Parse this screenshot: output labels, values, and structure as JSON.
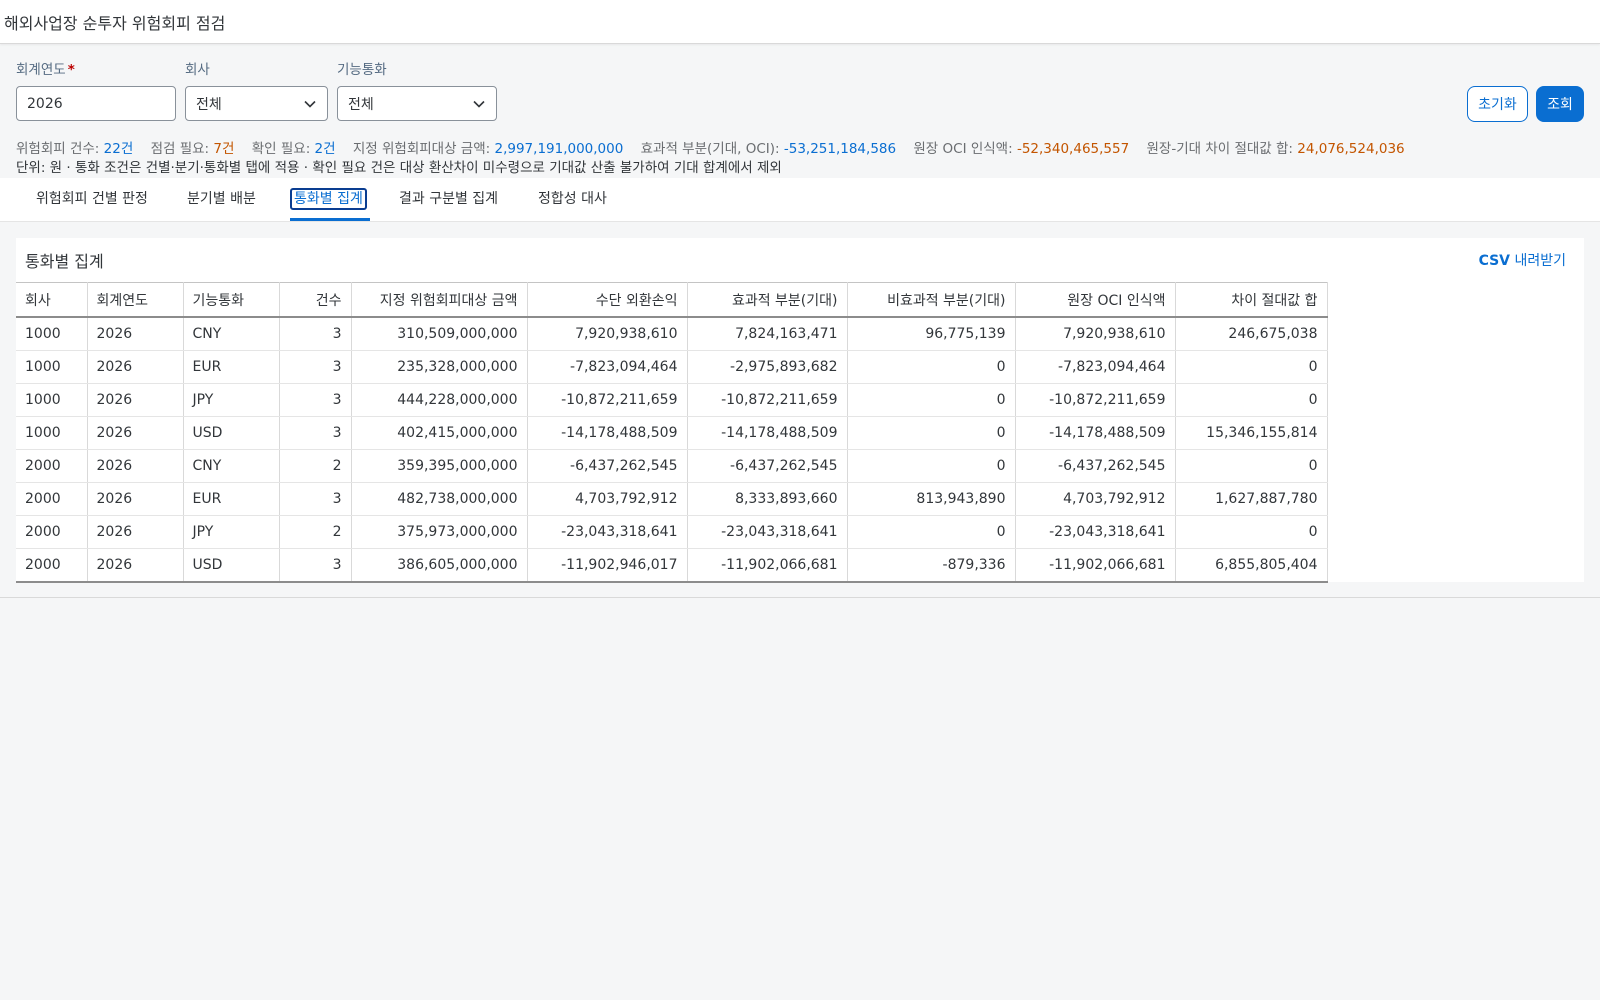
{
  "app": {
    "title": "해외사업장 순투자 위험회피 점검"
  },
  "filters": {
    "fiscal_year_label": "회계연도",
    "fiscal_year_required_mark": "*",
    "fiscal_year_value": "2026",
    "company_label": "회사",
    "company_value": "전체",
    "currency_label": "기능통화",
    "currency_value": "전체",
    "reset_label": "초기화",
    "search_label": "조회"
  },
  "summary": {
    "hedge_count_label": "위험회피 건수:",
    "hedge_count_value": "22건",
    "check_needed_label": "점검 필요:",
    "check_needed_value": "7건",
    "confirm_needed_label": "확인 필요:",
    "confirm_needed_value": "2건",
    "designated_amount_label": "지정 위험회피대상 금액:",
    "designated_amount_value": "2,997,191,000,000",
    "effective_label": "효과적 부분(기대, OCI):",
    "effective_value": "-53,251,184,586",
    "ledger_oci_label": "원장 OCI 인식액:",
    "ledger_oci_value": "-52,340,465,557",
    "diff_label": "원장-기대 차이 절대값 합:",
    "diff_value": "24,076,524,036",
    "note": "단위: 원 · 통화 조건은 건별·분기·통화별 탭에 적용 · 확인 필요 건은 대상 환산차이 미수령으로 기대값 산출 불가하여 기대 합계에서 제외"
  },
  "tabs": [
    {
      "label": "위험회피 건별 판정"
    },
    {
      "label": "분기별 배분"
    },
    {
      "label": "통화별 집계"
    },
    {
      "label": "결과 구분별 집계"
    },
    {
      "label": "정합성 대사"
    }
  ],
  "active_tab": "통화별 집계",
  "panel": {
    "title": "통화별 집계",
    "csv_prefix": "CSV",
    "csv_suffix": " 내려받기"
  },
  "table": {
    "columns": [
      {
        "label": "회사"
      },
      {
        "label": "회계연도"
      },
      {
        "label": "기능통화"
      },
      {
        "label": "건수"
      },
      {
        "label": "지정 위험회피대상 금액"
      },
      {
        "label": "수단 외환손익"
      },
      {
        "label": "효과적 부분(기대)"
      },
      {
        "label": "비효과적 부분(기대)"
      },
      {
        "label": "원장 OCI 인식액"
      },
      {
        "label": "차이 절대값 합"
      }
    ],
    "rows": [
      [
        "1000",
        "2026",
        "CNY",
        "3",
        "310,509,000,000",
        "7,920,938,610",
        "7,824,163,471",
        "96,775,139",
        "7,920,938,610",
        "246,675,038"
      ],
      [
        "1000",
        "2026",
        "EUR",
        "3",
        "235,328,000,000",
        "-7,823,094,464",
        "-2,975,893,682",
        "0",
        "-7,823,094,464",
        "0"
      ],
      [
        "1000",
        "2026",
        "JPY",
        "3",
        "444,228,000,000",
        "-10,872,211,659",
        "-10,872,211,659",
        "0",
        "-10,872,211,659",
        "0"
      ],
      [
        "1000",
        "2026",
        "USD",
        "3",
        "402,415,000,000",
        "-14,178,488,509",
        "-14,178,488,509",
        "0",
        "-14,178,488,509",
        "15,346,155,814"
      ],
      [
        "2000",
        "2026",
        "CNY",
        "2",
        "359,395,000,000",
        "-6,437,262,545",
        "-6,437,262,545",
        "0",
        "-6,437,262,545",
        "0"
      ],
      [
        "2000",
        "2026",
        "EUR",
        "3",
        "482,738,000,000",
        "4,703,792,912",
        "8,333,893,660",
        "813,943,890",
        "4,703,792,912",
        "1,627,887,780"
      ],
      [
        "2000",
        "2026",
        "JPY",
        "2",
        "375,973,000,000",
        "-23,043,318,641",
        "-23,043,318,641",
        "0",
        "-23,043,318,641",
        "0"
      ],
      [
        "2000",
        "2026",
        "USD",
        "3",
        "386,605,000,000",
        "-11,902,946,017",
        "-11,902,066,681",
        "-879,336",
        "-11,902,066,681",
        "6,855,805,404"
      ]
    ]
  },
  "colors": {
    "accent": "#0a6ed1",
    "warning": "#c35500",
    "required": "#bb0000"
  },
  "icons": {
    "select_chevron": "chevron-down-icon"
  }
}
